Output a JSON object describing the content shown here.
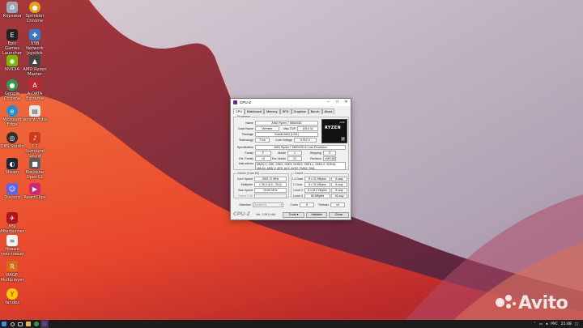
{
  "desktop": {
    "icons": [
      {
        "label": "Корзина",
        "icon": "recycle-bin-icon",
        "color": "#9aa7b6"
      },
      {
        "label": "Sprinkler Chrome",
        "icon": "chrome-icon",
        "color": "#e3a21a"
      },
      {
        "label": "Epic Games Launcher",
        "icon": "epic-games-icon",
        "color": "#222222"
      },
      {
        "label": "USB Network Joystick",
        "icon": "joystick-icon",
        "color": "#3a78c9"
      },
      {
        "label": "NVIDIA",
        "icon": "nvidia-icon",
        "color": "#76b900"
      },
      {
        "label": "AMD Ryzen Master",
        "icon": "amd-icon",
        "color": "#444444"
      },
      {
        "label": "Google Chrome",
        "icon": "chrome-icon",
        "color": "#2c9c4a"
      },
      {
        "label": "A-DATA Extreme",
        "icon": "adata-icon",
        "color": "#c0282d"
      },
      {
        "label": "Microsoft Edge",
        "icon": "edge-icon",
        "color": "#1f8fd6"
      },
      {
        "label": "winmtr/tdsc",
        "icon": "file-icon",
        "color": "#e8e8e8"
      },
      {
        "label": "OBS Studio",
        "icon": "obs-icon",
        "color": "#302e31"
      },
      {
        "label": "7.1 Surround Sound",
        "icon": "speaker-icon",
        "color": "#cc3b1e"
      },
      {
        "label": "Steam",
        "icon": "steam-icon",
        "color": "#1b2838"
      },
      {
        "label": "Вокселы OpenGL",
        "icon": "app-icon",
        "color": "#5d5d5d"
      },
      {
        "label": "Discord",
        "icon": "discord-icon",
        "color": "#5865f2"
      },
      {
        "label": "ReactClips",
        "icon": "app-icon",
        "color": "#d4247a"
      },
      {
        "label": "MSI Afterburner",
        "icon": "msi-icon",
        "color": "#b0141b"
      },
      {
        "label": "Новый текстовый ...",
        "icon": "text-file-icon",
        "color": "#f4f4f4"
      },
      {
        "label": "RAGE Multiplayer",
        "icon": "rage-icon",
        "color": "#dd6b12"
      },
      {
        "label": "Yandex",
        "icon": "yandex-icon",
        "color": "#ffcc00"
      }
    ]
  },
  "window": {
    "title": "CPU-Z",
    "controls": {
      "minimize": "–",
      "maximize": "□",
      "close": "✕"
    },
    "tabs": [
      "CPU",
      "Mainboard",
      "Memory",
      "SPD",
      "Graphics",
      "Bench",
      "About"
    ],
    "active_tab": "CPU",
    "processor": {
      "section": "Processor",
      "name_label": "Name",
      "name": "AMD Ryzen 7 5800X3D",
      "codename_label": "Code Name",
      "codename": "Vermeer",
      "maxtdp_label": "Max TDP",
      "maxtdp": "105.0 W",
      "package_label": "Package",
      "package": "Socket AM4 (1331)",
      "technology_label": "Technology",
      "technology": "7 nm",
      "voltage_label": "Core Voltage",
      "voltage": "0.912 V",
      "spec_label": "Specification",
      "spec": "AMD Ryzen 7 5800X3D 8-Core Processor",
      "family_label": "Family",
      "family": "F",
      "model_label": "Model",
      "model": "1",
      "stepping_label": "Stepping",
      "stepping": "2",
      "extfamily_label": "Ext. Family",
      "extfamily": "19",
      "extmodel_label": "Ext. Model",
      "extmodel": "21",
      "revision_label": "Revision",
      "revision": "VMR-B2",
      "instr_label": "Instructions",
      "instr_1": "MMX(+), SSE, SSE2, SSE3, SSSE3, SSE4.1, SSE4.2, SSE4A,",
      "instr_2": "x86-64, AMD-V, AES, AVX, AVX2, FMA3, SHA"
    },
    "logo": {
      "brand": "AMD",
      "text": "RYZEN",
      "num": "7"
    },
    "clocks": {
      "section": "Clocks (Core #0)",
      "corespeed_label": "Core Speed",
      "corespeed": "3392.72 MHz",
      "multiplier_label": "Multiplier",
      "multiplier": "x 36.0 (5.5 - 34.0)",
      "busspeed_label": "Bus Speed",
      "busspeed": "99.80 MHz",
      "ratedfsb_label": "Rated FSB",
      "ratedfsb": ""
    },
    "cache": {
      "section": "Cache",
      "l1d_label": "L1 Data",
      "l1d": "8 x 32 KBytes",
      "l1d_way": "8-way",
      "l1i_label": "L1 Inst.",
      "l1i": "8 x 32 KBytes",
      "l1i_way": "8-way",
      "l2_label": "Level 2",
      "l2": "8 x 512 KBytes",
      "l2_way": "8-way",
      "l3_label": "Level 3",
      "l3": "96 MBytes",
      "l3_way": "16-way"
    },
    "selection": {
      "label": "Selection",
      "value": "Socket #1",
      "cores_label": "Cores",
      "cores": "8",
      "threads_label": "Threads",
      "threads": "16"
    },
    "footer": {
      "brand": "CPU-Z",
      "version": "Ver. 2.09.0.x64",
      "tools": "Tools",
      "validate": "Validate",
      "close": "Close"
    }
  },
  "taskbar": {
    "lang": "РУС",
    "time": "21:48"
  },
  "watermark": {
    "text": "Avito"
  }
}
